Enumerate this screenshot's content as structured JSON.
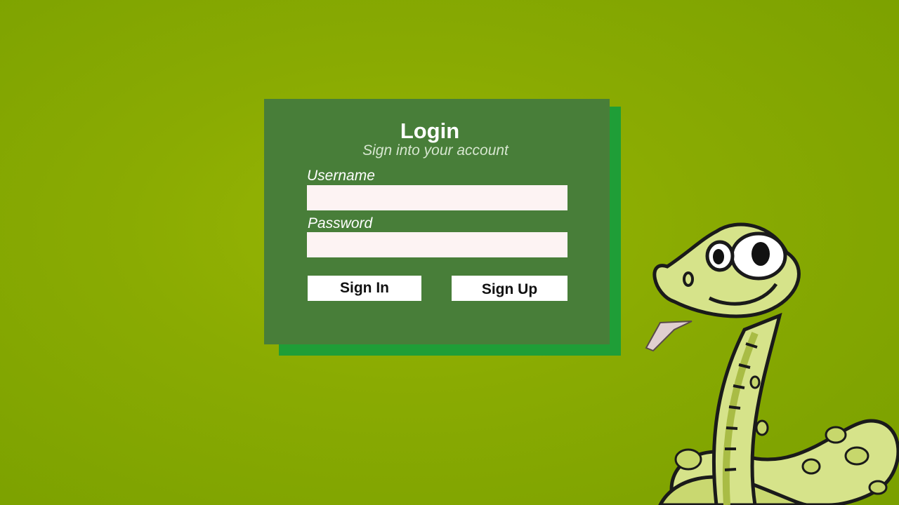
{
  "login": {
    "title": "Login",
    "subtitle": "Sign into your account",
    "username_label": "Username",
    "username_value": "",
    "password_label": "Password",
    "password_value": "",
    "signin_label": "Sign In",
    "signup_label": "Sign Up"
  },
  "colors": {
    "background": "#8aab02",
    "card": "#487e39",
    "card_shadow": "#1f9e37",
    "input_bg": "#fdf3f3"
  },
  "decor": {
    "mascot_icon": "snake-mascot-icon"
  }
}
